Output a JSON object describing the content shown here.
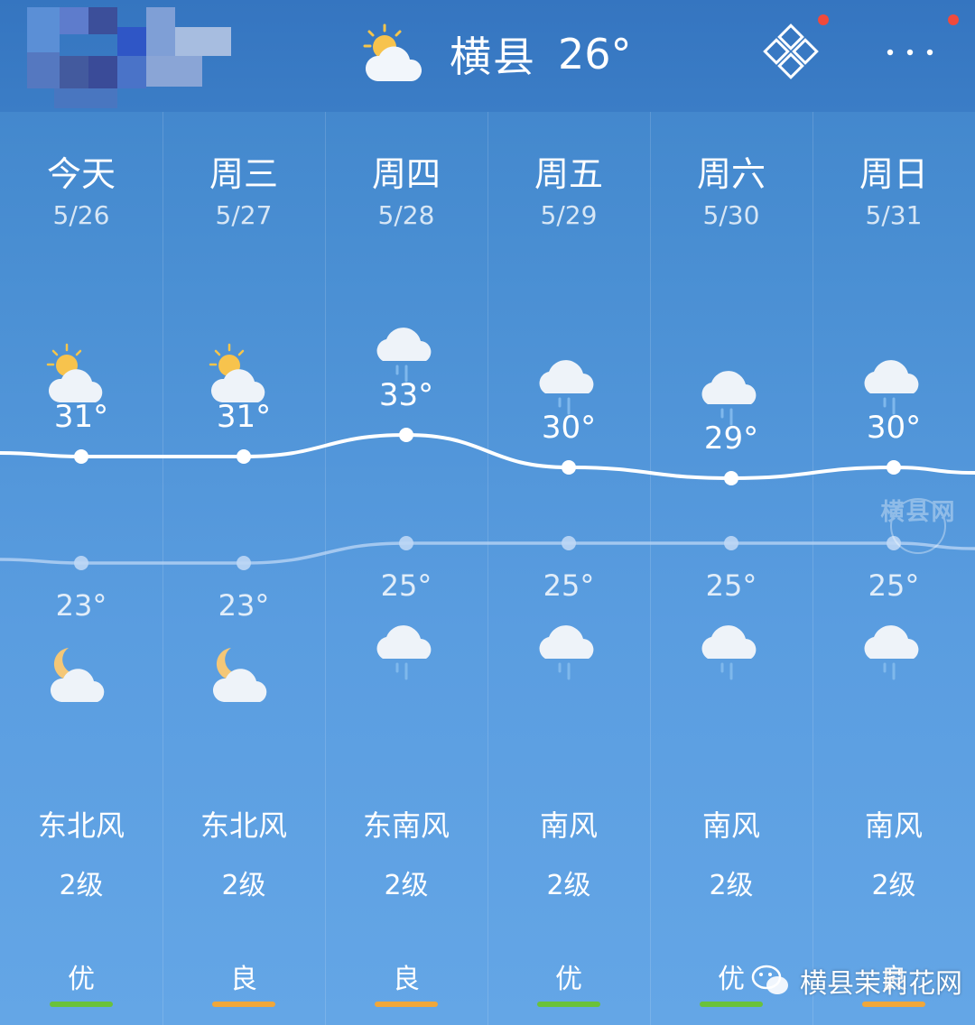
{
  "header": {
    "city": "横县",
    "current_temp": "26°",
    "current_icon": "partly-cloudy-day-icon"
  },
  "days": [
    {
      "name": "今天",
      "date": "5/26",
      "high": "31°",
      "low": "23°",
      "day_icon": "partly-cloudy-day-icon",
      "night_icon": "partly-cloudy-night-icon",
      "wind_dir": "东北风",
      "wind_level": "2级",
      "air_quality": "优",
      "aq_color": "#6ac23a",
      "high_value": 31,
      "low_value": 23
    },
    {
      "name": "周三",
      "date": "5/27",
      "high": "31°",
      "low": "23°",
      "day_icon": "partly-cloudy-day-icon",
      "night_icon": "partly-cloudy-night-icon",
      "wind_dir": "东北风",
      "wind_level": "2级",
      "air_quality": "良",
      "aq_color": "#f0a73a",
      "high_value": 31,
      "low_value": 23
    },
    {
      "name": "周四",
      "date": "5/28",
      "high": "33°",
      "low": "25°",
      "day_icon": "rain-icon",
      "night_icon": "rain-icon",
      "wind_dir": "东南风",
      "wind_level": "2级",
      "air_quality": "良",
      "aq_color": "#f0a73a",
      "high_value": 33,
      "low_value": 25
    },
    {
      "name": "周五",
      "date": "5/29",
      "high": "30°",
      "low": "25°",
      "day_icon": "rain-icon",
      "night_icon": "rain-icon",
      "wind_dir": "南风",
      "wind_level": "2级",
      "air_quality": "优",
      "aq_color": "#6ac23a",
      "high_value": 30,
      "low_value": 25
    },
    {
      "name": "周六",
      "date": "5/30",
      "high": "29°",
      "low": "25°",
      "day_icon": "rain-icon",
      "night_icon": "rain-icon",
      "wind_dir": "南风",
      "wind_level": "2级",
      "air_quality": "优",
      "aq_color": "#6ac23a",
      "high_value": 29,
      "low_value": 25
    },
    {
      "name": "周日",
      "date": "5/31",
      "high": "30°",
      "low": "25°",
      "day_icon": "rain-icon",
      "night_icon": "rain-icon",
      "wind_dir": "南风",
      "wind_level": "2级",
      "air_quality": "良",
      "aq_color": "#f0a73a",
      "high_value": 30,
      "low_value": 25
    }
  ],
  "watermark": {
    "text": "横县网"
  },
  "wechat": {
    "label": "横县茉莉花网",
    "icon": "wechat-icon"
  }
}
